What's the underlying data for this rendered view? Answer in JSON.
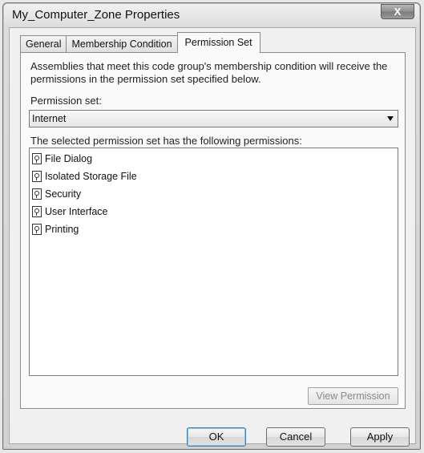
{
  "window": {
    "title": "My_Computer_Zone Properties",
    "close_label": "X"
  },
  "tabs": [
    {
      "label": "General",
      "active": false
    },
    {
      "label": "Membership Condition",
      "active": false
    },
    {
      "label": "Permission Set",
      "active": true
    }
  ],
  "panel": {
    "description": "Assemblies that meet this code group's membership condition will receive the permissions in the permission set specified below.",
    "permission_set_label": "Permission set:",
    "permission_set_value": "Internet",
    "permissions_label": "The selected permission set has the following permissions:",
    "permissions": [
      "File Dialog",
      "Isolated Storage File",
      "Security",
      "User Interface",
      "Printing"
    ],
    "view_permission_label": "View Permission"
  },
  "buttons": {
    "ok": "OK",
    "cancel": "Cancel",
    "apply": "Apply"
  }
}
